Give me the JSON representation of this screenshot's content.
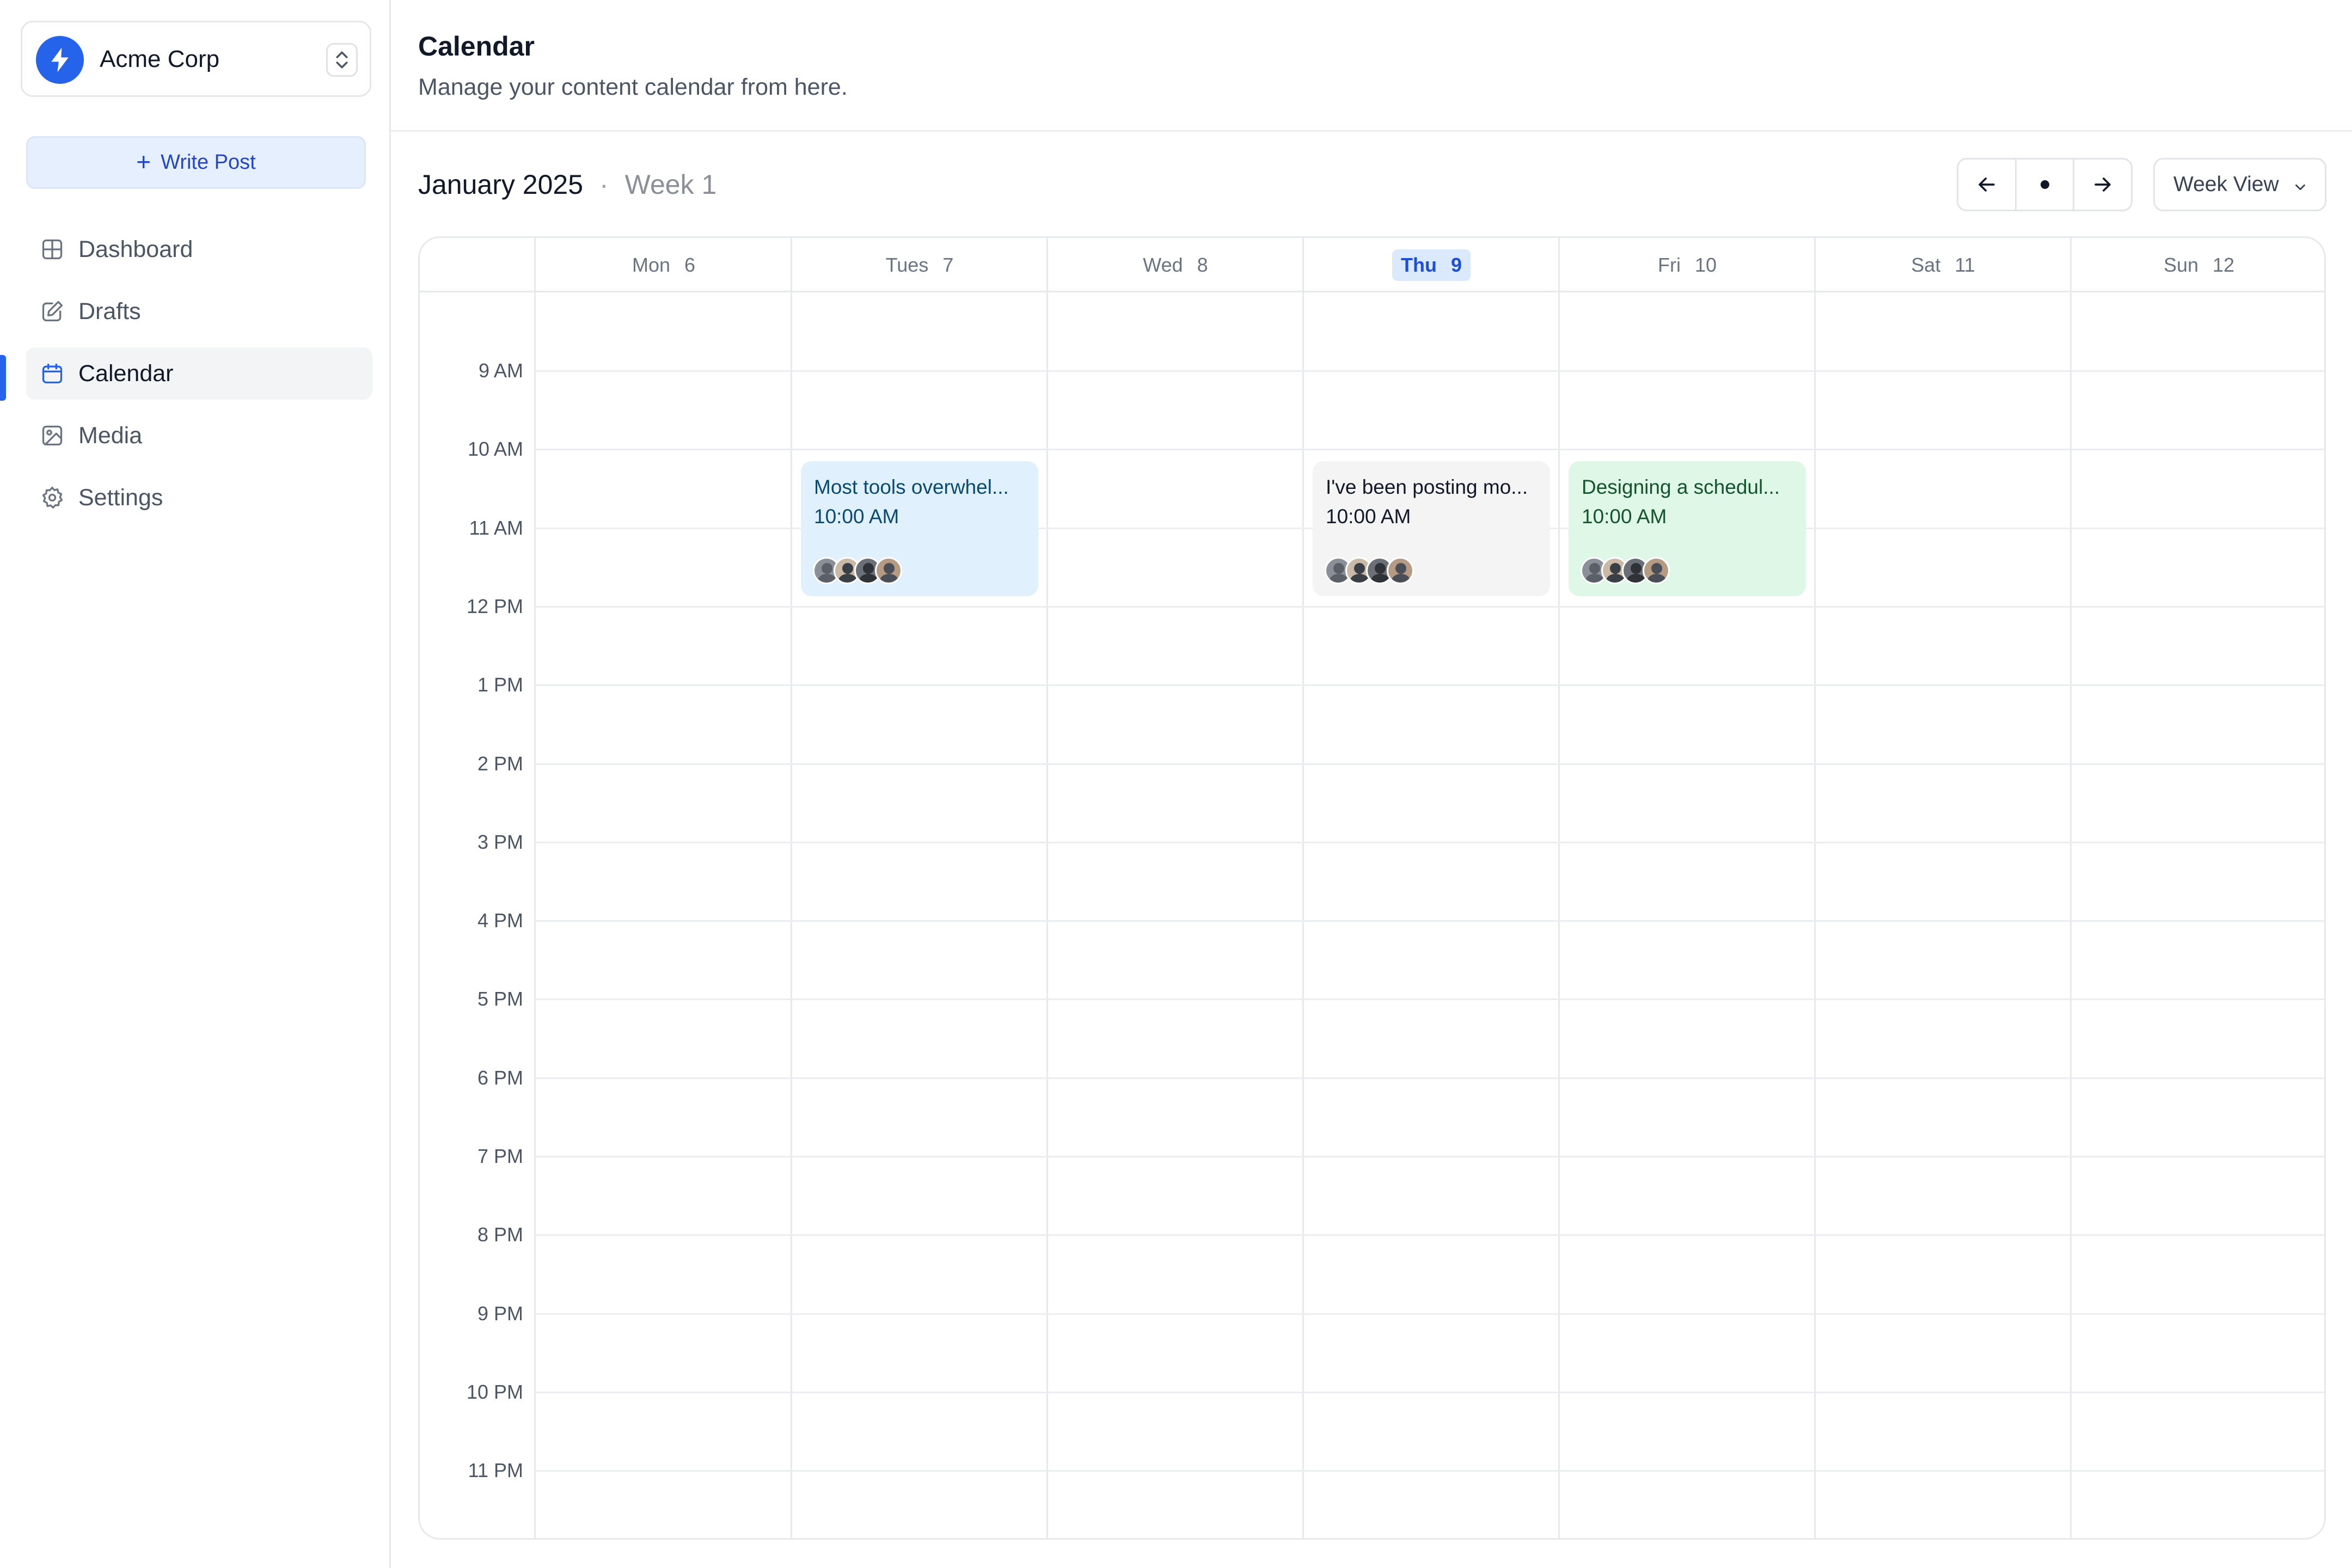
{
  "org": {
    "name": "Acme Corp",
    "logo_icon": "bolt-icon",
    "accent": "#2563eb"
  },
  "sidebar": {
    "write_button": "Write Post",
    "items": [
      {
        "label": "Dashboard",
        "icon": "grid-icon",
        "active": false
      },
      {
        "label": "Drafts",
        "icon": "edit-icon",
        "active": false
      },
      {
        "label": "Calendar",
        "icon": "calendar-icon",
        "active": true
      },
      {
        "label": "Media",
        "icon": "image-icon",
        "active": false
      },
      {
        "label": "Settings",
        "icon": "gear-icon",
        "active": false
      }
    ]
  },
  "header": {
    "title": "Calendar",
    "subtitle": "Manage your content calendar from here."
  },
  "toolbar": {
    "month": "January 2025",
    "separator": "·",
    "week": "Week 1",
    "view": "Week View"
  },
  "calendar": {
    "days": [
      {
        "name": "Mon",
        "num": "6",
        "today": false
      },
      {
        "name": "Tues",
        "num": "7",
        "today": false
      },
      {
        "name": "Wed",
        "num": "8",
        "today": false
      },
      {
        "name": "Thu",
        "num": "9",
        "today": true
      },
      {
        "name": "Fri",
        "num": "10",
        "today": false
      },
      {
        "name": "Sat",
        "num": "11",
        "today": false
      },
      {
        "name": "Sun",
        "num": "12",
        "today": false
      }
    ],
    "hours": [
      "9 AM",
      "10 AM",
      "11 AM",
      "12 PM",
      "1 PM",
      "2 PM",
      "3 PM",
      "4 PM",
      "5 PM",
      "6 PM",
      "7 PM",
      "8 PM",
      "9 PM",
      "10 PM",
      "11 PM"
    ],
    "events": [
      {
        "day": 1,
        "title": "Most tools overwhel...",
        "time": "10:00 AM",
        "bg": "#e0f0fd",
        "color": "#0b4a6f"
      },
      {
        "day": 3,
        "title": "I've been posting mo...",
        "time": "10:00 AM",
        "bg": "#f4f4f5",
        "color": "#111827"
      },
      {
        "day": 4,
        "title": "Designing a schedul...",
        "time": "10:00 AM",
        "bg": "#def7e7",
        "color": "#14532d"
      }
    ]
  }
}
